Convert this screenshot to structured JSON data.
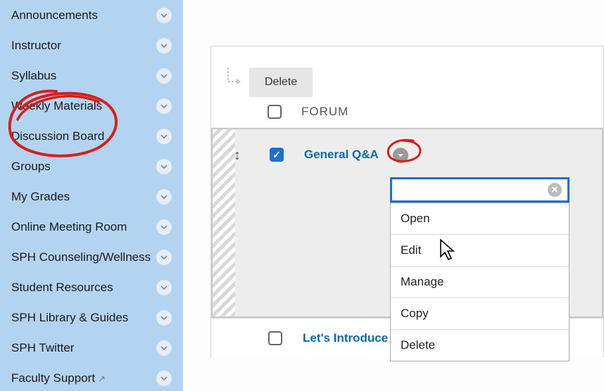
{
  "sidebar": {
    "items": [
      {
        "label": "Announcements"
      },
      {
        "label": "Instructor"
      },
      {
        "label": "Syllabus"
      },
      {
        "label": "Weekly Materials"
      },
      {
        "label": "Discussion Board"
      },
      {
        "label": "Groups"
      },
      {
        "label": "My Grades"
      },
      {
        "label": "Online Meeting Room"
      },
      {
        "label": "SPH Counseling/Wellness"
      },
      {
        "label": "Student Resources"
      },
      {
        "label": "SPH Library & Guides"
      },
      {
        "label": "SPH Twitter"
      },
      {
        "label": "Faculty Support",
        "external": true
      }
    ]
  },
  "toolbar": {
    "delete_label": "Delete"
  },
  "columns": {
    "forum": "FORUM"
  },
  "forums": [
    {
      "title": "General Q&A",
      "checked": true
    },
    {
      "title": "Let's Introduce"
    }
  ],
  "context_menu": {
    "items": [
      {
        "label": "Open"
      },
      {
        "label": "Edit"
      },
      {
        "label": "Manage"
      },
      {
        "label": "Copy"
      },
      {
        "label": "Delete"
      }
    ]
  }
}
